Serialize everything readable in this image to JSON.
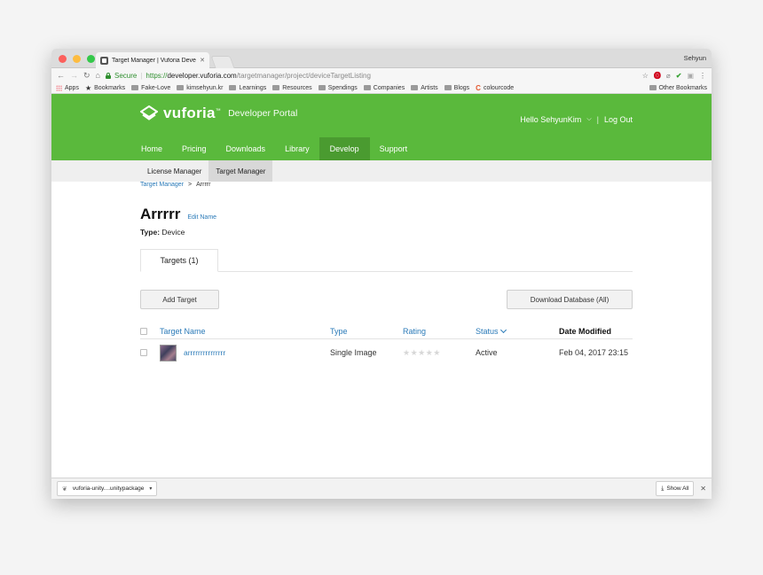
{
  "browser": {
    "tab_title": "Target Manager | Vuforia Develo",
    "profile_name": "Sehyun",
    "url": {
      "secure_label": "Secure",
      "scheme": "https://",
      "host": "developer.vuforia.com",
      "path": "/targetmanager/project/deviceTargetListing"
    },
    "bookmarks": [
      {
        "label": "Apps",
        "icon": "apps-grid-icon"
      },
      {
        "label": "Bookmarks",
        "icon": "star-icon"
      },
      {
        "label": "Fake-Love",
        "icon": "folder-icon"
      },
      {
        "label": "kimsehyun.kr",
        "icon": "folder-icon"
      },
      {
        "label": "Learnings",
        "icon": "folder-icon"
      },
      {
        "label": "Resources",
        "icon": "folder-icon"
      },
      {
        "label": "Spendings",
        "icon": "folder-icon"
      },
      {
        "label": "Companies",
        "icon": "folder-icon"
      },
      {
        "label": "Artists",
        "icon": "folder-icon"
      },
      {
        "label": "Blogs",
        "icon": "folder-icon"
      },
      {
        "label": "colourcode",
        "icon": "colourcode-c-icon"
      }
    ],
    "other_bookmarks": "Other Bookmarks"
  },
  "portal": {
    "logo_name": "vuforia",
    "logo_tm": "™",
    "logo_sub": "Developer Portal",
    "greeting": "Hello SehyunKim",
    "logout": "Log Out",
    "nav": [
      "Home",
      "Pricing",
      "Downloads",
      "Library",
      "Develop",
      "Support"
    ],
    "nav_active": "Develop",
    "subnav": [
      "License Manager",
      "Target Manager"
    ],
    "subnav_active": "Target Manager",
    "brand_color": "#5ab93c"
  },
  "content": {
    "breadcrumb_link": "Target Manager",
    "breadcrumb_sep": ">",
    "breadcrumb_current": "Arrrrr",
    "database_name": "Arrrrr",
    "edit_name": "Edit Name",
    "type_label": "Type:",
    "type_value": "Device",
    "tab_label": "Targets (1)",
    "add_target": "Add Target",
    "download_db": "Download Database (All)",
    "columns": {
      "name": "Target Name",
      "type": "Type",
      "rating": "Rating",
      "status": "Status",
      "date": "Date Modified"
    },
    "rows": [
      {
        "name": "arrrrrrrrrrrrrrr",
        "type": "Single Image",
        "rating": 0,
        "rating_max": 5,
        "status": "Active",
        "date": "Feb 04, 2017 23:15"
      }
    ]
  },
  "downloads": {
    "file": "vuforia-unity....unitypackage",
    "show_all": "Show All"
  }
}
